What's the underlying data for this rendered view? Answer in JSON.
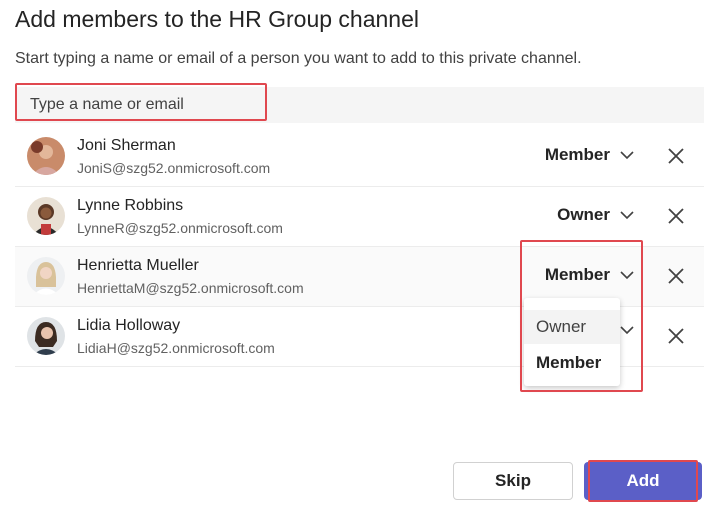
{
  "dialog": {
    "title": "Add members to the HR Group channel",
    "subtitle": "Start typing a name or email of a person you want to add to this private channel."
  },
  "search": {
    "placeholder": "Type a name or email",
    "value": ""
  },
  "members": [
    {
      "name": "Joni Sherman",
      "email": "JoniS@szg52.onmicrosoft.com",
      "role": "Member"
    },
    {
      "name": "Lynne Robbins",
      "email": "LynneR@szg52.onmicrosoft.com",
      "role": "Owner"
    },
    {
      "name": "Henrietta Mueller",
      "email": "HenriettaM@szg52.onmicrosoft.com",
      "role": "Member"
    },
    {
      "name": "Lidia Holloway",
      "email": "LidiaH@szg52.onmicrosoft.com",
      "role": ""
    }
  ],
  "role_dropdown": {
    "options": [
      "Owner",
      "Member"
    ],
    "selected": "Member"
  },
  "buttons": {
    "skip": "Skip",
    "add": "Add"
  },
  "colors": {
    "accent": "#5b5fc7",
    "highlight": "#e0484f"
  }
}
